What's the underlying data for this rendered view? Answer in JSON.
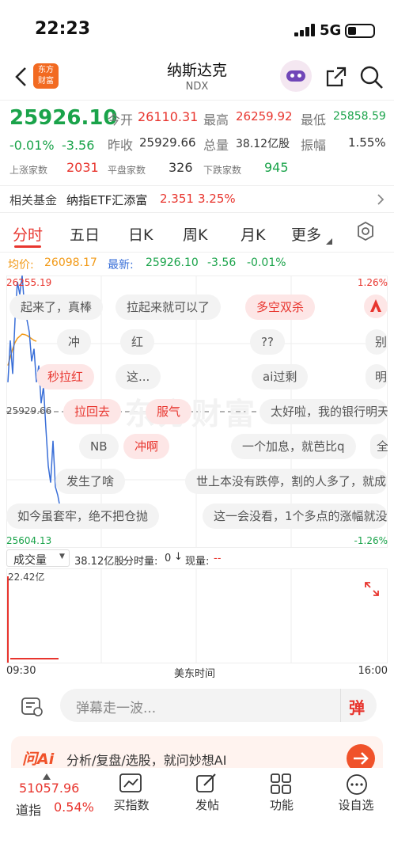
{
  "status_bar": {
    "time": "22:23",
    "network": "5G"
  },
  "header": {
    "logo_text_1": "东方",
    "logo_text_2": "财富",
    "title": "纳斯达克",
    "code": "NDX"
  },
  "quote": {
    "price": "25926.10",
    "change_pct": "-0.01%",
    "change": "-3.56",
    "open_label": "今开",
    "open": "26110.31",
    "high_label": "最高",
    "high": "26259.92",
    "low_label": "最低",
    "low": "25858.59",
    "prev_close_label": "昨收",
    "prev_close": "25929.66",
    "volume_label": "总量",
    "volume": "38.12亿股",
    "amplitude_label": "振幅",
    "amplitude": "1.55%",
    "up_label": "上涨家数",
    "up": "2031",
    "flat_label": "平盘家数",
    "flat": "326",
    "down_label": "下跌家数",
    "down": "945"
  },
  "fund": {
    "label": "相关基金",
    "name": "纳指ETF汇添富",
    "price": "2.351",
    "pct": "3.25%"
  },
  "tabs": [
    "分时",
    "五日",
    "日K",
    "周K",
    "月K",
    "更多"
  ],
  "info_line": {
    "avg_label": "均价:",
    "avg": "26098.17",
    "latest_label": "最新:",
    "latest": "25926.10",
    "change": "-3.56",
    "pct": "-0.01%"
  },
  "chart": {
    "top_price": "26255.19",
    "top_pct": "1.26%",
    "mid_price": "25929.66",
    "bottom_price": "25604.13",
    "bottom_pct": "-1.26%",
    "watermark": "东方财富"
  },
  "danmu": [
    "起来了，真棒",
    "拉起来就可以了",
    "多空双杀",
    "冲",
    "红",
    "??",
    "别",
    "秒拉红",
    "这...",
    "ai过剩",
    "明",
    "拉回去",
    "服气",
    "太好啦，我的银行明天",
    "NB",
    "冲啊",
    "一个加息，就芭比q",
    "全",
    "发生了啥",
    "世上本没有跌停，割的人多了，就成",
    "如今虽套牢，绝不把仓抛",
    "这一会没看，1个多点的涨幅就没"
  ],
  "volume": {
    "label": "成交量",
    "total": "38.12亿股",
    "detail_label": "分时量:",
    "detail_value": "0",
    "current_label": "现量:",
    "current_value": "--",
    "max": "22.42亿",
    "start_time": "09:30",
    "mid_label": "美东时间",
    "end_time": "16:00"
  },
  "comment": {
    "placeholder": "弹幕走一波...",
    "danmu_btn": "弹"
  },
  "ai": {
    "logo": "问Ai",
    "text": "分析/复盘/选股，就问妙想AI"
  },
  "bottom": {
    "index_value": "51057.96",
    "index_label": "道指",
    "index_pct": "0.54%",
    "nav": [
      "买指数",
      "发帖",
      "功能",
      "设自选"
    ]
  },
  "price_series": {
    "prev_close": 25929.66,
    "y_max": 26255.19,
    "y_min": 25604.13,
    "price": [
      26000,
      26100,
      26020,
      26150,
      26240,
      26210,
      26255,
      26180,
      26150,
      26120,
      26050,
      26080,
      26000,
      26040,
      25950,
      25990,
      25890,
      25800,
      25760,
      25860,
      25750,
      25730,
      25700
    ],
    "avg": [
      26040,
      26060,
      26080,
      26095,
      26105,
      26110,
      26115,
      26114,
      26112,
      26108,
      26104,
      26100,
      26098
    ]
  }
}
